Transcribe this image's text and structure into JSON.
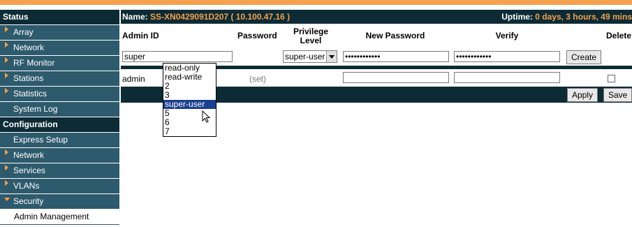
{
  "sidebar": {
    "status_header": "Status",
    "status_items": [
      {
        "label": "Array"
      },
      {
        "label": "Network"
      },
      {
        "label": "RF Monitor"
      },
      {
        "label": "Stations"
      },
      {
        "label": "Statistics"
      },
      {
        "label": "System Log"
      }
    ],
    "config_header": "Configuration",
    "config_items": [
      {
        "label": "Express Setup"
      },
      {
        "label": "Network"
      },
      {
        "label": "Services"
      },
      {
        "label": "VLANs"
      },
      {
        "label": "Security"
      }
    ],
    "sub_item": "Admin Management"
  },
  "topbar": {
    "name_label": "Name:",
    "name_value": "SS-XN0429091D207",
    "ip": "( 10.100.47.16 )",
    "uptime_label": "Uptime:",
    "uptime_value": "0 days, 3 hours, 49 mins"
  },
  "table": {
    "headers": {
      "admin_id": "Admin ID",
      "password": "Password",
      "privilege_level": "Privilege Level",
      "new_password": "New Password",
      "verify": "Verify",
      "delete": "Delete"
    },
    "new_row": {
      "admin_id": "super",
      "privilege": "super-user",
      "new_password": "••••••••••••",
      "verify": "••••••••••••",
      "create_label": "Create"
    },
    "existing_row": {
      "admin_id": "admin",
      "password": "(set)"
    }
  },
  "dropdown": {
    "options": [
      "read-only",
      "read-write",
      "2",
      "3",
      "super-user",
      "5",
      "6",
      "7"
    ],
    "highlighted": "super-user"
  },
  "actions": {
    "apply_label": "Apply",
    "save_label": "Save"
  },
  "colors": {
    "accent": "#f5a04c",
    "sidebar_item": "#2d5a6c",
    "header_dark": "#0d2b35",
    "highlight": "#1b3f8f"
  }
}
